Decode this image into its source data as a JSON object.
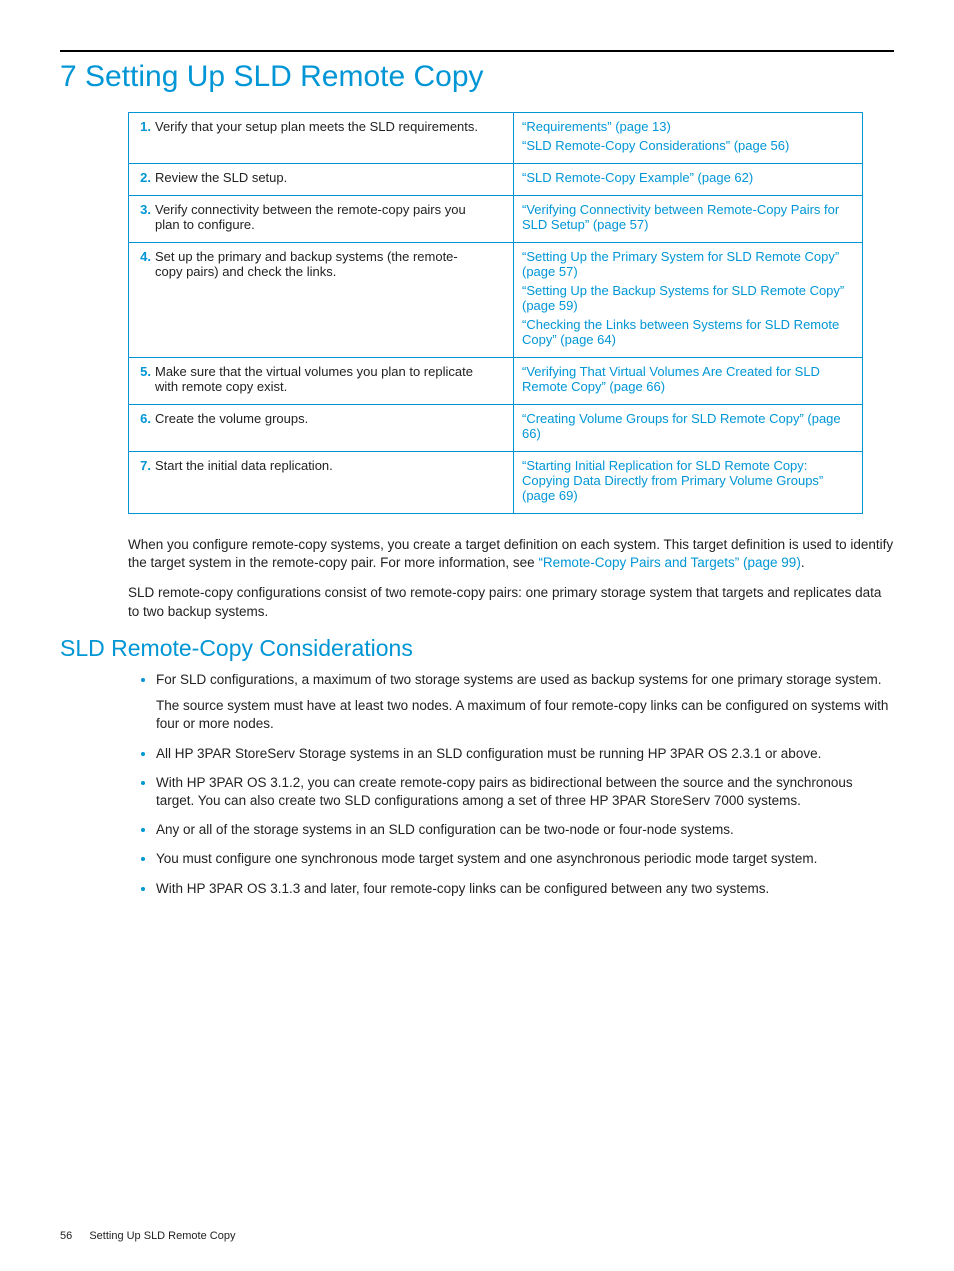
{
  "chapter_title": "7 Setting Up SLD Remote Copy",
  "steps": [
    {
      "n": "1.",
      "text": "Verify that your setup plan meets the SLD requirements.",
      "refs": [
        "“Requirements” (page 13)",
        "“SLD Remote-Copy Considerations” (page 56)"
      ]
    },
    {
      "n": "2.",
      "text": "Review the SLD setup.",
      "refs": [
        "“SLD Remote-Copy Example” (page 62)"
      ]
    },
    {
      "n": "3.",
      "text": "Verify connectivity between the remote-copy pairs you plan to configure.",
      "refs": [
        "“Verifying Connectivity between Remote-Copy Pairs for SLD Setup” (page 57)"
      ]
    },
    {
      "n": "4.",
      "text": "Set up the primary and backup systems (the remote-copy pairs) and check the links.",
      "refs": [
        "“Setting Up the Primary System for SLD Remote Copy” (page 57)",
        "“Setting Up the Backup Systems for SLD Remote Copy” (page 59)",
        "“Checking the Links between Systems for SLD Remote Copy” (page 64)"
      ]
    },
    {
      "n": "5.",
      "text": "Make sure that the virtual volumes you plan to replicate with remote copy exist.",
      "refs": [
        "“Verifying That Virtual Volumes Are Created for SLD Remote Copy” (page 66)"
      ]
    },
    {
      "n": "6.",
      "text": "Create the volume groups.",
      "refs": [
        "“Creating Volume Groups for SLD Remote Copy” (page 66)"
      ]
    },
    {
      "n": "7.",
      "text": "Start the initial data replication.",
      "refs": [
        "“Starting Initial Replication for SLD Remote Copy: Copying Data Directly from Primary Volume Groups” (page 69)"
      ]
    }
  ],
  "para1_a": "When you configure remote-copy systems, you create a target definition on each system. This target definition is used to identify the target system in the remote-copy pair. For more information, see ",
  "para1_link": "“Remote-Copy Pairs and Targets” (page 99)",
  "para1_b": ".",
  "para2": "SLD remote-copy configurations consist of two remote-copy pairs: one primary storage system that targets and replicates data to two backup systems.",
  "section_title": "SLD Remote-Copy Considerations",
  "bullets": [
    {
      "text": "For SLD configurations, a maximum of two storage systems are used as backup systems for one primary storage system.",
      "sub": "The source system must have at least two nodes. A maximum of four remote-copy links can be configured on systems with four or more nodes."
    },
    {
      "text": "All HP 3PAR StoreServ Storage systems in an SLD configuration must be running HP 3PAR OS 2.3.1 or above."
    },
    {
      "text": "With HP 3PAR OS 3.1.2, you can create remote-copy pairs as bidirectional between the source and the synchronous target. You can also create two SLD configurations among a set of three HP 3PAR StoreServ 7000 systems."
    },
    {
      "text": "Any or all of the storage systems in an SLD configuration can be two-node or four-node systems."
    },
    {
      "text": "You must configure one synchronous mode target system and one asynchronous periodic mode target system."
    },
    {
      "text": "With HP 3PAR OS 3.1.3 and later, four remote-copy links can be configured between any two systems."
    }
  ],
  "footer": {
    "page": "56",
    "title": "Setting Up SLD Remote Copy"
  }
}
